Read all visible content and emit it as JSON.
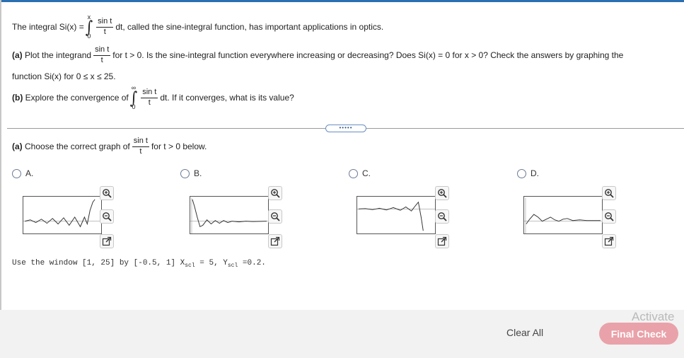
{
  "intro": {
    "prefix": "The integral Si(x) =",
    "upper": "x",
    "lower": "0",
    "num": "sin t",
    "den": "t",
    "suffix": "dt, called the sine-integral function, has important applications in optics."
  },
  "part_a": {
    "label": "(a)",
    "text1": "Plot the integrand",
    "num": "sin t",
    "den": "t",
    "text2": "for t > 0. Is the sine-integral function everywhere increasing or decreasing? Does Si(x) = 0 for x > 0? Check the answers by graphing the",
    "text3": "function Si(x) for 0 ≤ x ≤ 25."
  },
  "part_b": {
    "label": "(b)",
    "text1": "Explore the convergence of",
    "upper": "∞",
    "lower": "0",
    "num": "sin t",
    "den": "t",
    "text2": "dt. If it converges, what is its value?"
  },
  "more_button": "•••••",
  "question": {
    "label": "(a)",
    "text1": "Choose the correct graph of",
    "num": "sin t",
    "den": "t",
    "text2": "for t > 0 below."
  },
  "options": [
    {
      "letter": "A."
    },
    {
      "letter": "B."
    },
    {
      "letter": "C."
    },
    {
      "letter": "D."
    }
  ],
  "window_text": {
    "prefix": "Use the window [1, 25] by [-0.5, 1] X",
    "xsub": "scl",
    "mid": "= 5, Y",
    "ysub": "scl",
    "suffix": "=0.2."
  },
  "buttons": {
    "clear": "Clear All",
    "final": "Final Check"
  },
  "watermark": "Activate"
}
